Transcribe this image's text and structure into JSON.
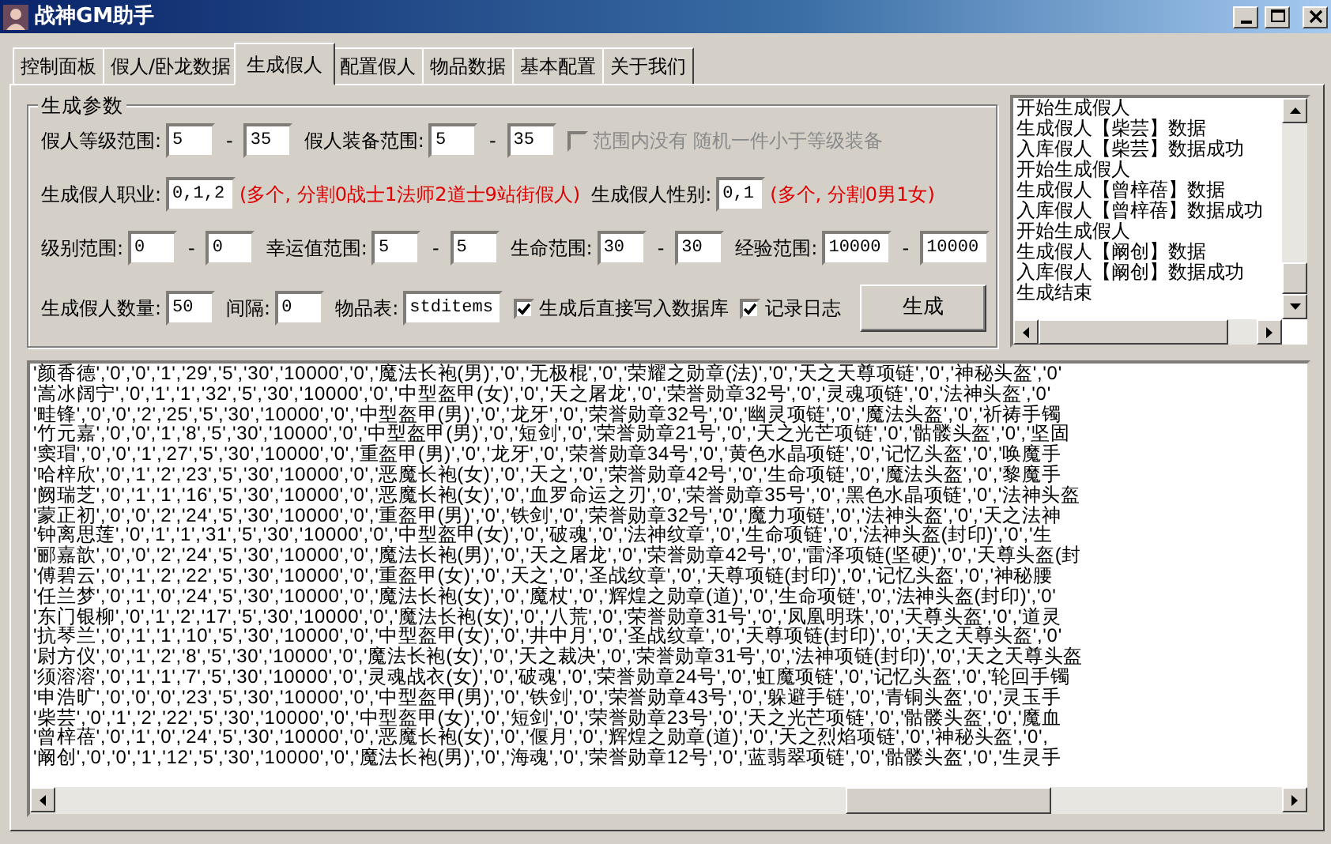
{
  "window": {
    "title": "战神GM助手"
  },
  "tabs": [
    {
      "label": "控制面板",
      "selected": false
    },
    {
      "label": "假人/卧龙数据",
      "selected": false
    },
    {
      "label": "生成假人",
      "selected": true
    },
    {
      "label": "配置假人",
      "selected": false
    },
    {
      "label": "物品数据",
      "selected": false
    },
    {
      "label": "基本配置",
      "selected": false
    },
    {
      "label": "关于我们",
      "selected": false
    }
  ],
  "params": {
    "title": "生成参数",
    "rows": [
      {
        "items": [
          {
            "kind": "label",
            "text": "假人等级范围:"
          },
          {
            "kind": "field",
            "value": "5"
          },
          {
            "kind": "dash",
            "text": "-"
          },
          {
            "kind": "field",
            "value": "35"
          },
          {
            "kind": "label",
            "text": "假人装备范围:"
          },
          {
            "kind": "field",
            "value": "5"
          },
          {
            "kind": "dash",
            "text": "-"
          },
          {
            "kind": "field",
            "value": "35"
          },
          {
            "kind": "checkbox",
            "text": "范围内没有 随机一件小于等级装备",
            "checked": false,
            "disabled": true
          }
        ]
      },
      {
        "items": [
          {
            "kind": "label",
            "text": "生成假人职业:"
          },
          {
            "kind": "field",
            "value": "0,1,2"
          },
          {
            "kind": "note",
            "text": "(多个, 分割0战士1法师2道士9站街假人)"
          },
          {
            "kind": "label",
            "text": "生成假人性别:"
          },
          {
            "kind": "field",
            "value": "0,1"
          },
          {
            "kind": "note",
            "text": "(多个, 分割0男1女)"
          }
        ]
      },
      {
        "items": [
          {
            "kind": "label",
            "text": "级别范围:"
          },
          {
            "kind": "field",
            "value": "0"
          },
          {
            "kind": "dash",
            "text": "-"
          },
          {
            "kind": "field",
            "value": "0"
          },
          {
            "kind": "label",
            "text": "幸运值范围:"
          },
          {
            "kind": "field",
            "value": "5"
          },
          {
            "kind": "dash",
            "text": "-"
          },
          {
            "kind": "field",
            "value": "5"
          },
          {
            "kind": "label",
            "text": "生命范围:"
          },
          {
            "kind": "field",
            "value": "30"
          },
          {
            "kind": "dash",
            "text": "-"
          },
          {
            "kind": "field",
            "value": "30"
          },
          {
            "kind": "label",
            "text": "经验范围:"
          },
          {
            "kind": "field",
            "value": "10000"
          },
          {
            "kind": "dash",
            "text": "-"
          },
          {
            "kind": "field",
            "value": "10000"
          }
        ]
      },
      {
        "items": [
          {
            "kind": "label",
            "text": "生成假人数量:"
          },
          {
            "kind": "field",
            "value": "50"
          },
          {
            "kind": "label",
            "text": "间隔:"
          },
          {
            "kind": "field",
            "value": "0"
          },
          {
            "kind": "label",
            "text": "物品表:"
          },
          {
            "kind": "field",
            "value": "stditems"
          },
          {
            "kind": "checkbox",
            "text": "生成后直接写入数据库",
            "checked": true,
            "disabled": false
          },
          {
            "kind": "checkbox",
            "text": "记录日志",
            "checked": true,
            "disabled": false
          },
          {
            "kind": "button",
            "text": "生成"
          }
        ]
      }
    ]
  },
  "log": [
    "开始生成假人",
    "生成假人【柴芸】数据",
    "入库假人【柴芸】数据成功",
    "开始生成假人",
    "生成假人【曾梓蓓】数据",
    "入库假人【曾梓蓓】数据成功",
    "开始生成假人",
    "生成假人【阚创】数据",
    "入库假人【阚创】数据成功",
    "生成结束"
  ],
  "output": [
    "'颜香德','0','0','1','29','5','30','10000','0','魔法长袍(男)','0','无极棍','0','荣耀之勋章(法)','0','天之天尊项链','0','神秘头盔','0'",
    "'嵩冰阔宁','0','1','1','32','5','30','10000','0','中型盔甲(女)','0','天之屠龙','0','荣誉勋章32号','0','灵魂项链','0','法神头盔','0'",
    "'畦锋','0','0','2','25','5','30','10000','0','中型盔甲(男)','0','龙牙','0','荣誉勋章32号','0','幽灵项链','0','魔法头盔','0','祈祷手镯",
    "'竹元嘉','0','0','1','8','5','30','10000','0','中型盔甲(男)','0','短剑','0','荣誉勋章21号','0','天之光芒项链','0','骷髅头盔','0','坚固",
    "'窦瑁','0','0','1','27','5','30','10000','0','重盔甲(男)','0','龙牙','0','荣誉勋章34号','0','黄色水晶项链','0','记忆头盔','0','唤魔手",
    "'哈梓欣','0','1','2','23','5','30','10000','0','恶魔长袍(女)','0','天之','0','荣誉勋章42号','0','生命项链','0','魔法头盔','0','黎魔手",
    "'阙瑞芝','0','1','1','16','5','30','10000','0','恶魔长袍(女)','0','血罗命运之刃','0','荣誉勋章35号','0','黑色水晶项链','0','法神头盔",
    "'蒙正初','0','0','2','24','5','30','10000','0','重盔甲(男)','0','铁剑','0','荣誉勋章32号','0','魔力项链','0','法神头盔','0','天之法神",
    "'钟离思莲','0','1','1','31','5','30','10000','0','中型盔甲(女)','0','破魂','0','法神纹章','0','生命项链','0','法神头盔(封印)','0','生",
    "'郦嘉歆','0','0','2','24','5','30','10000','0','魔法长袍(男)','0','天之屠龙','0','荣誉勋章42号','0','雷泽项链(坚硬)','0','天尊头盔(封",
    "'傅碧云','0','1','2','22','5','30','10000','0','重盔甲(女)','0','天之','0','圣战纹章','0','天尊项链(封印)','0','记忆头盔','0','神秘腰",
    "'任兰梦','0','1','0','24','5','30','10000','0','魔法长袍(女)','0','魔杖','0','辉煌之勋章(道)','0','生命项链','0','法神头盔(封印)','0'",
    "'东门银柳','0','1','2','17','5','30','10000','0','魔法长袍(女)','0','八荒','0','荣誉勋章31号','0','凤凰明珠','0','天尊头盔','0','道灵",
    "'抗琴兰','0','1','1','10','5','30','10000','0','中型盔甲(女)','0','井中月','0','圣战纹章','0','天尊项链(封印)','0','天之天尊头盔','0'",
    "'尉方仪','0','1','2','8','5','30','10000','0','魔法长袍(女)','0','天之裁决','0','荣誉勋章31号','0','法神项链(封印)','0','天之天尊头盔",
    "'须溶溶','0','1','1','7','5','30','10000','0','灵魂战衣(女)','0','破魂','0','荣誉勋章24号','0','虹魔项链','0','记忆头盔','0','轮回手镯",
    "'申浩旷','0','0','0','23','5','30','10000','0','中型盔甲(男)','0','铁剑','0','荣誉勋章43号','0','躲避手链','0','青铜头盔','0','灵玉手",
    "'柴芸','0','1','2','22','5','30','10000','0','中型盔甲(女)','0','短剑','0','荣誉勋章23号','0','天之光芒项链','0','骷髅头盔','0','魔血",
    "'曾梓蓓','0','1','0','24','5','30','10000','0','恶魔长袍(女)','0','偃月','0','辉煌之勋章(道)','0','天之烈焰项链','0','神秘头盔','0',",
    "'阚创','0','0','1','12','5','30','10000','0','魔法长袍(男)','0','海魂','0','荣誉勋章12号','0','蓝翡翠项链','0','骷髅头盔','0','生灵手"
  ]
}
